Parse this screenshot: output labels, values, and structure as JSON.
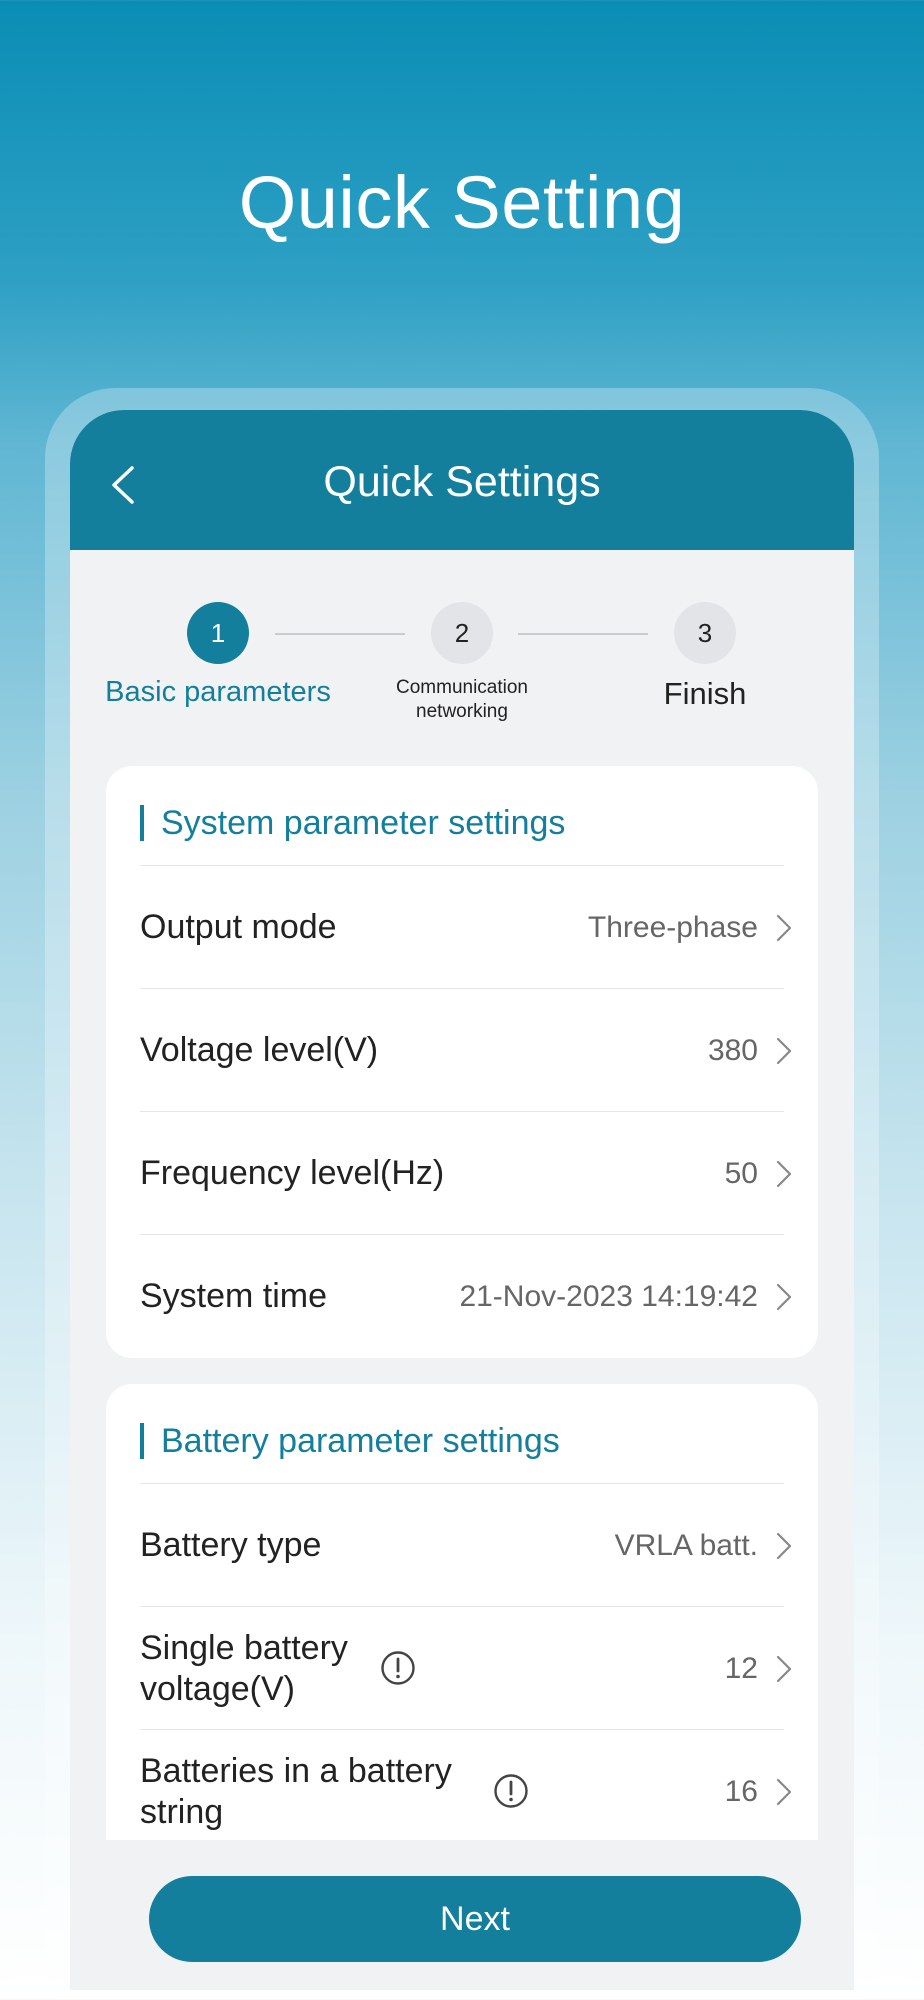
{
  "hero": {
    "title": "Quick Setting"
  },
  "header": {
    "title": "Quick Settings"
  },
  "steps": [
    {
      "number": "1",
      "label": "Basic parameters"
    },
    {
      "number": "2",
      "label_line1": "Communication",
      "label_line2": "networking"
    },
    {
      "number": "3",
      "label": "Finish"
    }
  ],
  "system_section": {
    "title": "System parameter settings",
    "rows": [
      {
        "label": "Output mode",
        "value": "Three-phase"
      },
      {
        "label": "Voltage level(V)",
        "value": "380"
      },
      {
        "label": "Frequency level(Hz)",
        "value": "50"
      },
      {
        "label": "System time",
        "value": "21-Nov-2023 14:19:42"
      }
    ]
  },
  "battery_section": {
    "title": "Battery parameter settings",
    "rows": [
      {
        "label": "Battery type",
        "value": "VRLA batt."
      },
      {
        "label_line1": "Single battery",
        "label_line2": "voltage(V)",
        "value": "12"
      },
      {
        "label_line1": "Batteries in a battery",
        "label_line2": "string",
        "value": "16"
      }
    ]
  },
  "footer": {
    "next_label": "Next"
  },
  "colors": {
    "primary": "#137f9c",
    "inactive_step": "#e2e4e7"
  }
}
